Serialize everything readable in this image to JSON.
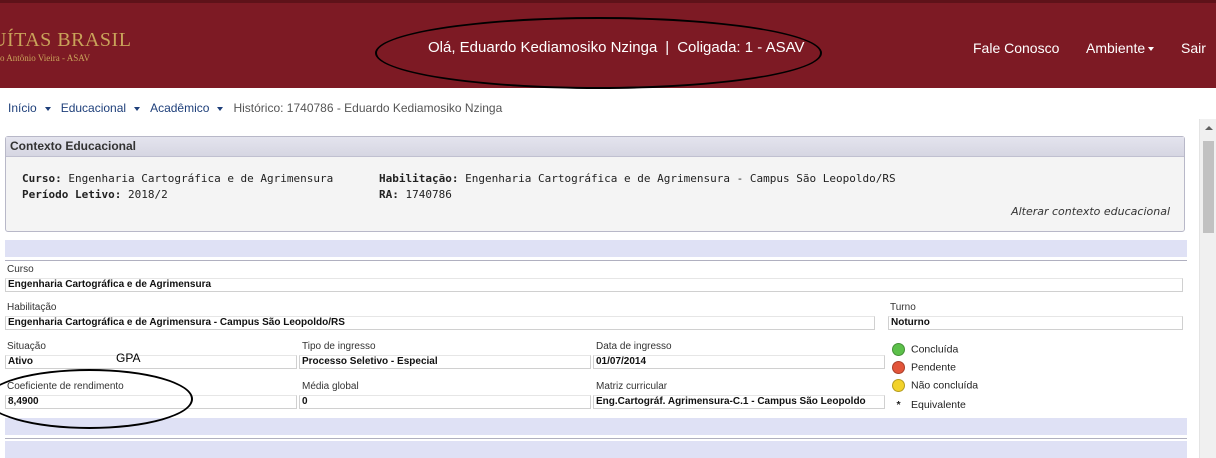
{
  "header": {
    "logo_line1": "UÍTAS BRASIL",
    "logo_line2": "ção Antônio Vieira - ASAV",
    "greeting_user": "Olá, Eduardo Kediamosiko Nzinga",
    "greeting_separator": "|",
    "greeting_coligada": "Coligada: 1 - ASAV",
    "nav": {
      "fale_conosco": "Fale Conosco",
      "ambiente": "Ambiente",
      "sair": "Sair"
    }
  },
  "breadcrumb": {
    "inicio": "Início",
    "educacional": "Educacional",
    "academico": "Acadêmico",
    "current": "Histórico: 1740786 - Eduardo Kediamosiko Nzinga"
  },
  "context": {
    "title": "Contexto Educacional",
    "curso_label": "Curso:",
    "curso_value": "Engenharia Cartográfica e de Agrimensura",
    "periodo_label": "Período Letivo:",
    "periodo_value": "2018/2",
    "habilitacao_label": "Habilitação:",
    "habilitacao_value": "Engenharia Cartográfica e de Agrimensura - Campus São Leopoldo/RS",
    "ra_label": "RA:",
    "ra_value": "1740786",
    "change_link": "Alterar contexto educacional"
  },
  "form": {
    "curso": {
      "label": "Curso",
      "value": "Engenharia Cartográfica e de Agrimensura"
    },
    "habilitacao": {
      "label": "Habilitação",
      "value": "Engenharia Cartográfica e de Agrimensura - Campus São Leopoldo/RS"
    },
    "turno": {
      "label": "Turno",
      "value": "Noturno"
    },
    "situacao": {
      "label": "Situação",
      "value": "Ativo"
    },
    "tipo_ingresso": {
      "label": "Tipo de ingresso",
      "value": "Processo Seletivo - Especial"
    },
    "data_ingresso": {
      "label": "Data de ingresso",
      "value": "01/07/2014"
    },
    "coeficiente": {
      "label": "Coeficiente de rendimento",
      "value": "8,4900"
    },
    "media_global": {
      "label": "Média global",
      "value": "0"
    },
    "matriz": {
      "label": "Matriz curricular",
      "value": "Eng.Cartográf. Agrimensura-C.1 - Campus São Leopoldo"
    }
  },
  "legend": {
    "concluida": "Concluída",
    "pendente": "Pendente",
    "nao_concluida": "Não concluída",
    "equivalente_symbol": "*",
    "equivalente": "Equivalente"
  },
  "annotation": {
    "gpa": "GPA"
  },
  "colors": {
    "header_bg": "#7d1a24",
    "link": "#1e3f7a",
    "band": "#dfe1f5",
    "green": "#5cc04a",
    "red": "#e2553a",
    "yellow": "#f2d22a"
  }
}
